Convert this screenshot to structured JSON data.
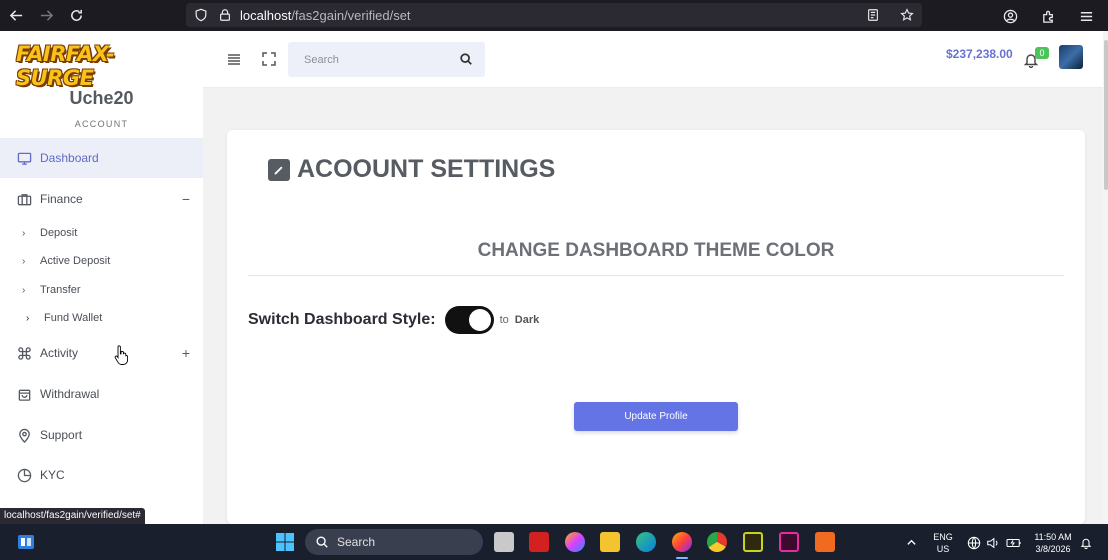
{
  "browser": {
    "url_host": "localhost",
    "url_path": "/fas2gain/verified/set",
    "status_link": "localhost/fas2gain/verified/set#"
  },
  "sidebar": {
    "logo_text": "FAIRFAX-SURGE",
    "username": "Uche20",
    "account_label": "ACCOUNT",
    "items": [
      {
        "label": "Dashboard",
        "icon": "monitor-icon"
      },
      {
        "label": "Finance",
        "icon": "briefcase-icon",
        "toggle": "−"
      },
      {
        "label": "Activity",
        "icon": "command-icon",
        "toggle": "+"
      },
      {
        "label": "Withdrawal",
        "icon": "bag-icon"
      },
      {
        "label": "Support",
        "icon": "location-pin-icon"
      },
      {
        "label": "KYC",
        "icon": "pie-chart-icon"
      }
    ],
    "finance_sub": [
      "Deposit",
      "Active Deposit",
      "Transfer",
      "Fund Wallet"
    ]
  },
  "header": {
    "search_placeholder": "Search",
    "balance": "$237,238.00",
    "notifications": "0"
  },
  "main": {
    "title": "ACOOUNT SETTINGS",
    "section_title": "CHANGE DASHBOARD THEME COLOR",
    "switch_label": "Switch Dashboard Style:",
    "switch_to": "to",
    "switch_target": "Dark",
    "switch_on": true,
    "update_button": "Update Profile"
  },
  "taskbar": {
    "search_label": "Search",
    "lang_top": "ENG",
    "lang_bottom": "US",
    "time": "11:50 AM",
    "date": "3/8/2026"
  },
  "colors": {
    "accent": "#6474e5",
    "sidebar_active_bg": "#eceef8",
    "badge": "#4bc25a"
  }
}
